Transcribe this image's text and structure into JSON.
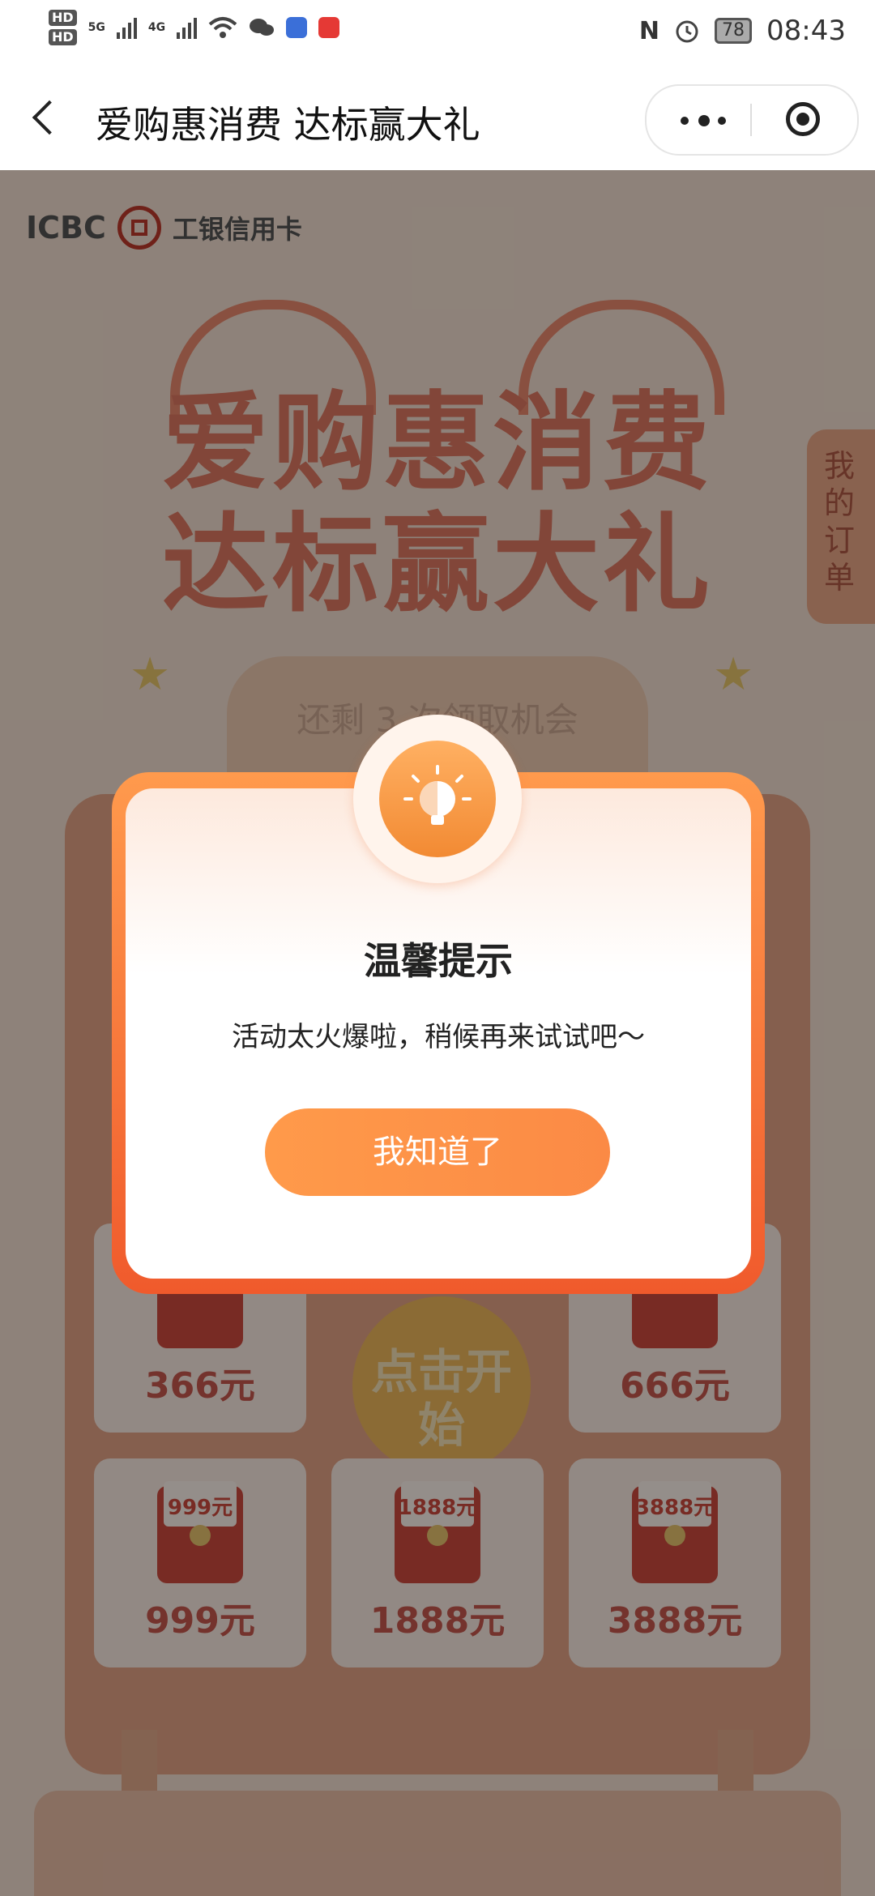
{
  "status_bar": {
    "hd1": "HD",
    "hd2": "HD",
    "net1": "5G",
    "net2": "4G",
    "battery": "78",
    "time": "08:43",
    "nfc_label": "N"
  },
  "nav": {
    "title": "爱购惠消费 达标赢大礼"
  },
  "page": {
    "brand_en": "ICBC",
    "brand_cn": "工银信用卡",
    "hero_line1": "爱购惠消费",
    "hero_line2": "达标赢大礼",
    "my_order": "我的订单",
    "remain": "还剩 3 次领取机会",
    "start_button": "点击开始",
    "prizes": [
      {
        "amount": "366元"
      },
      {
        "amount": "666元"
      },
      {
        "env_label": "999元",
        "amount": "999元"
      },
      {
        "env_label": "1888元",
        "amount": "1888元"
      },
      {
        "env_label": "3888元",
        "amount": "3888元"
      }
    ]
  },
  "modal": {
    "title": "温馨提示",
    "message": "活动太火爆啦，稍候再来试试吧～",
    "ok_button": "我知道了"
  },
  "colors": {
    "accent": "#ff9a4a",
    "modal_frame": "#f05a2c"
  }
}
